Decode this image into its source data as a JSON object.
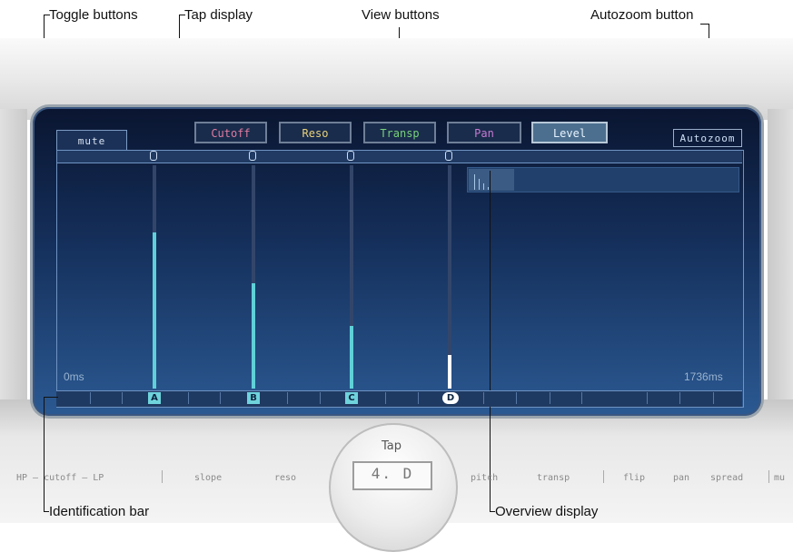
{
  "callouts": {
    "toggle_buttons": "Toggle buttons",
    "tap_display": "Tap display",
    "view_buttons": "View buttons",
    "autozoom_button": "Autozoom button",
    "identification_bar": "Identification bar",
    "overview_display": "Overview display"
  },
  "view_buttons": [
    {
      "label": "Cutoff",
      "color": "#e07aa0"
    },
    {
      "label": "Reso",
      "color": "#e9d27a"
    },
    {
      "label": "Transp",
      "color": "#78d17b"
    },
    {
      "label": "Pan",
      "color": "#c77ad3"
    },
    {
      "label": "Level",
      "color": "#e8f4ff",
      "selected": true
    }
  ],
  "autozoom_label": "Autozoom",
  "mute_tab_label": "mute",
  "taps": [
    {
      "id": "A",
      "level": 0.7
    },
    {
      "id": "B",
      "level": 0.47
    },
    {
      "id": "C",
      "level": 0.28
    },
    {
      "id": "D",
      "level": 0.15,
      "selected": true
    }
  ],
  "time_start": "0ms",
  "time_end": "1736ms",
  "tap_knob": {
    "label": "Tap",
    "value": "4. D"
  },
  "params": {
    "hp_cutoff_lp": "HP – cutoff – LP",
    "slope": "slope",
    "reso": "reso",
    "pitch": "pitch",
    "transp": "transp",
    "flip": "flip",
    "pan": "pan",
    "spread": "spread",
    "mu": "mu"
  },
  "colors": {
    "tap_bar": "#5fd0d8",
    "tap_bar_selected": "#ffffff",
    "display_bg": "#15305c"
  }
}
